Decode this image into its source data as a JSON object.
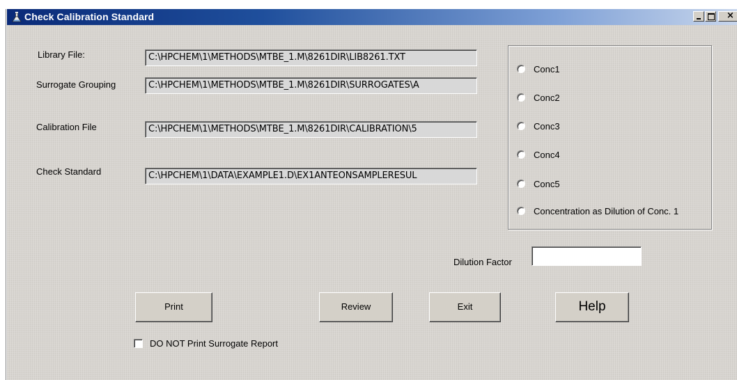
{
  "window": {
    "title": "Check Calibration Standard",
    "controls": {
      "minimize": "_",
      "maximize": "□",
      "close": "×"
    }
  },
  "fields": {
    "library_file": {
      "label": "Library File:",
      "value": "C:\\HPCHEM\\1\\METHODS\\MTBE_1.M\\8261DIR\\LIB8261.TXT"
    },
    "surrogate_grouping": {
      "label": "Surrogate Grouping",
      "value": "C:\\HPCHEM\\1\\METHODS\\MTBE_1.M\\8261DIR\\SURROGATES\\A"
    },
    "calibration_file": {
      "label": "Calibration File",
      "value": "C:\\HPCHEM\\1\\METHODS\\MTBE_1.M\\8261DIR\\CALIBRATION\\5"
    },
    "check_standard": {
      "label": "Check Standard",
      "value": "C:\\HPCHEM\\1\\DATA\\EXAMPLE1.D\\EX1ANTEONSAMPLERESUL"
    }
  },
  "concentration_options": [
    {
      "label": "Conc1",
      "selected": false
    },
    {
      "label": "Conc2",
      "selected": false
    },
    {
      "label": "Conc3",
      "selected": false
    },
    {
      "label": "Conc4",
      "selected": false
    },
    {
      "label": "Conc5",
      "selected": false
    },
    {
      "label": "Concentration as Dilution of Conc. 1",
      "selected": false
    }
  ],
  "dilution": {
    "label": "Dilution Factor",
    "value": ""
  },
  "buttons": {
    "print": "Print",
    "review": "Review",
    "exit": "Exit",
    "help": "Help"
  },
  "surrogate_report": {
    "label": "DO NOT Print Surrogate Report",
    "checked": false
  },
  "colors": {
    "title_start": "#0a2a78",
    "title_end": "#c8d6ec",
    "dialog_bg": "#d8d5d0",
    "field_bg": "#d8d8d8"
  }
}
